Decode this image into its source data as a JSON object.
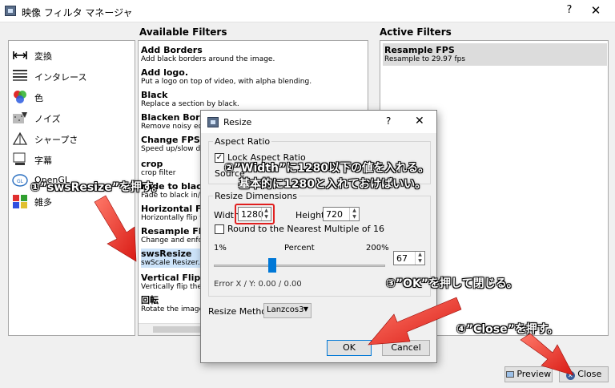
{
  "window": {
    "title": "映像 フィルタ マネージャ",
    "help": "?",
    "close": "✕"
  },
  "sections": {
    "available": "Available Filters",
    "active": "Active Filters"
  },
  "categories": [
    {
      "label": "変換",
      "icon": "transform-icon"
    },
    {
      "label": "インタレース",
      "icon": "interlace-icon"
    },
    {
      "label": "色",
      "icon": "color-icon"
    },
    {
      "label": "ノイズ",
      "icon": "noise-icon"
    },
    {
      "label": "シャープさ",
      "icon": "sharpness-icon"
    },
    {
      "label": "字幕",
      "icon": "subtitle-icon"
    },
    {
      "label": "OpenGL",
      "icon": "opengl-icon"
    },
    {
      "label": "雑多",
      "icon": "misc-icon"
    }
  ],
  "filters": [
    {
      "name": "Add Borders",
      "desc": "Add black borders around the image."
    },
    {
      "name": "Add logo.",
      "desc": "Put a logo on top of video, with alpha blending."
    },
    {
      "name": "Black",
      "desc": "Replace a section by black."
    },
    {
      "name": "Blacken Borders.",
      "desc": "Remove noisy edge"
    },
    {
      "name": "Change FPS",
      "desc": "Speed up/slow dow"
    },
    {
      "name": "crop",
      "desc": "crop filter"
    },
    {
      "name": "Fade to black",
      "desc": "Fade to black in/out"
    },
    {
      "name": "Horizontal Flip",
      "desc": "Horizontally flip the"
    },
    {
      "name": "Resample FPS",
      "desc": "Change and enforce"
    },
    {
      "name": "swsResize",
      "desc": "swScale Resizer."
    },
    {
      "name": "Vertical Flip",
      "desc": "Vertically flip the ima"
    },
    {
      "name": "回転",
      "desc": "Rotate the image by"
    }
  ],
  "active_filters": [
    {
      "name": "Resample FPS",
      "desc": "Resample to 29.97 fps"
    }
  ],
  "buttons": {
    "preview": "Preview",
    "close": "Close"
  },
  "dialog": {
    "title": "Resize",
    "help": "?",
    "close": "✕",
    "aspect": {
      "group": "Aspect Ratio",
      "lock_label": "Lock Aspect Ratio",
      "source_label": "Source"
    },
    "dims": {
      "group": "Resize Dimensions",
      "width_label": "Width:",
      "width_value": "1280",
      "height_label": "Height:",
      "height_value": "720",
      "round_label": "Round to the Nearest Multiple of 16",
      "percent_min": "1%",
      "percent_label": "Percent",
      "percent_max": "200%",
      "percent_value": "67",
      "error_text": "Error X / Y:  0.00 / 0.00"
    },
    "method_label": "Resize Method:",
    "method_value": "Lanzcos3",
    "ok": "OK",
    "cancel": "Cancel"
  },
  "annotations": {
    "step1": "①”swsResize”を押す。",
    "step2_line1": "②”Width”に1280以下の値を入れる。",
    "step2_line2": "基本的に1280と入れておけばいい。",
    "step3": "③”OK”を押して閉じる。",
    "step4": "④”Close”を押す。"
  },
  "colors": {
    "selection": "#cde4fa",
    "arrow_red": "#e8231f",
    "highlight_box": "#e02020"
  }
}
